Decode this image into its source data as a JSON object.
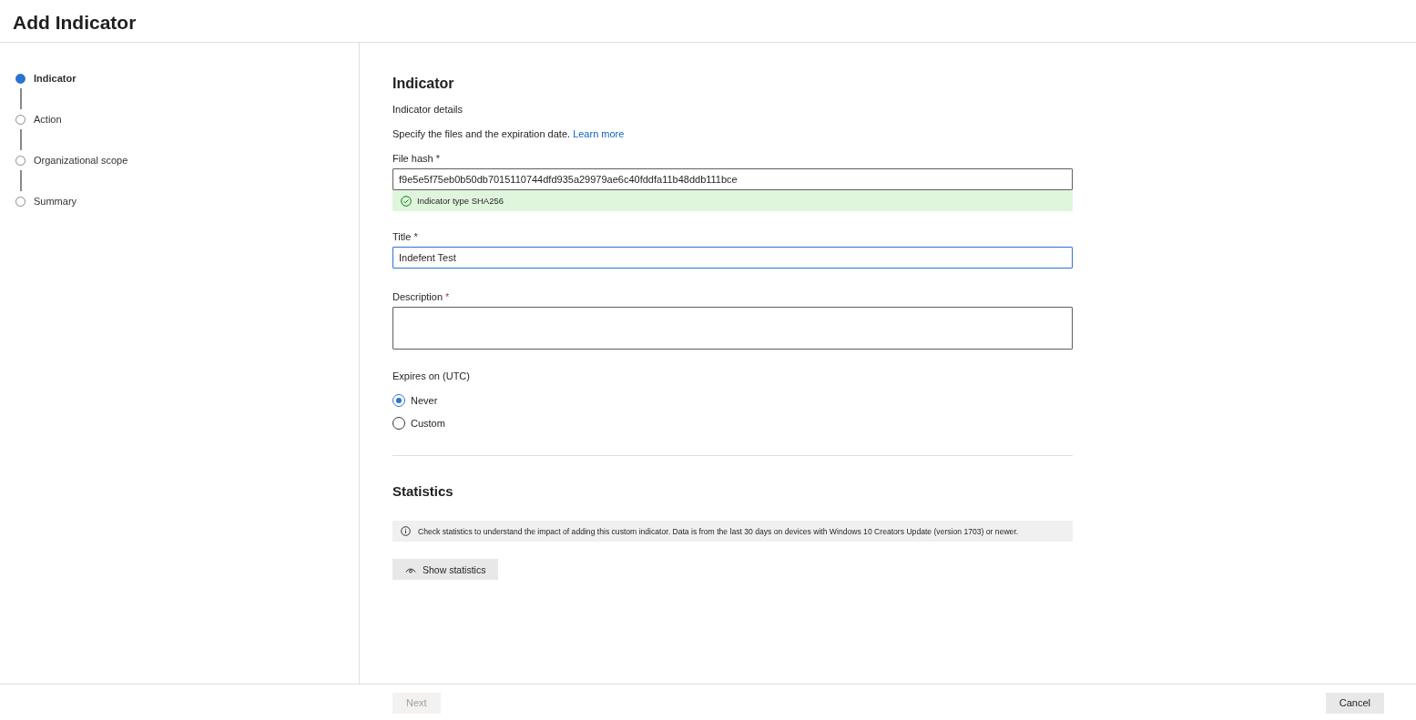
{
  "page": {
    "title": "Add Indicator"
  },
  "steps": [
    {
      "label": "Indicator",
      "selected": true
    },
    {
      "label": "Action",
      "selected": false
    },
    {
      "label": "Organizational scope",
      "selected": false
    },
    {
      "label": "Summary",
      "selected": false
    }
  ],
  "section": {
    "title": "Indicator",
    "subtitle": "Indicator details",
    "description": "Specify the files and the expiration date.",
    "link": "Learn more"
  },
  "file_hash": {
    "label": "File hash",
    "required_mark": "*",
    "value": "f9e5e5f75eb0b50db7015110744dfd935a29979ae6c40fddfa11b48ddb111bce",
    "validation": {
      "valid": true,
      "text": "Indicator type SHA256"
    }
  },
  "title_field": {
    "label": "Title",
    "required_mark": "*",
    "value": "Indefent Test",
    "focused": true
  },
  "description_field": {
    "label": "Description",
    "required_mark": "*"
  },
  "expires": {
    "label": "Expires on (UTC)",
    "options": [
      {
        "label": "Never",
        "selected": true
      },
      {
        "label": "Custom",
        "selected": false
      }
    ]
  },
  "statistics": {
    "title": "Statistics",
    "info": "Check statistics to understand the impact of adding this custom indicator. Data is from the last 30 days on devices with Windows 10 Creators Update (version 1703) or newer.",
    "button": "Show statistics"
  },
  "footer": {
    "buttons": [
      {
        "label": "Next",
        "disabled": true
      },
      {
        "label": "Cancel",
        "disabled": false
      }
    ]
  }
}
